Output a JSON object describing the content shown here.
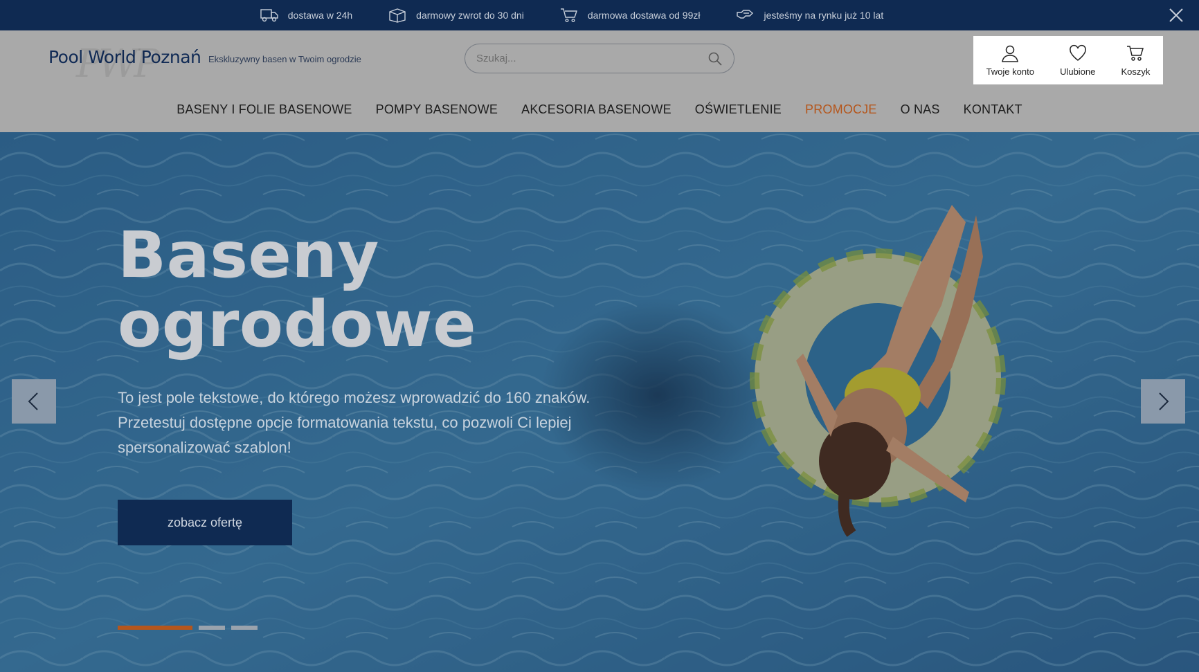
{
  "topbar": {
    "items": [
      {
        "icon": "delivery-truck-icon",
        "label": "dostawa w 24h"
      },
      {
        "icon": "return-box-icon",
        "label": "darmowy zwrot do 30 dni"
      },
      {
        "icon": "cart-icon",
        "label": "darmowa dostawa od 99zł"
      },
      {
        "icon": "handshake-icon",
        "label": "jesteśmy na rynku już 10 lat"
      }
    ],
    "close_icon": "close-icon"
  },
  "header": {
    "logo": "Pool World Poznań",
    "logo_mark": "PWP",
    "tagline": "Ekskluzywny basen w Twoim ogrodzie",
    "search_placeholder": "Szukaj...",
    "account": "Twoje konto",
    "favorites": "Ulubione",
    "cart": "Koszyk"
  },
  "nav": [
    {
      "label": "BASENY I FOLIE BASENOWE"
    },
    {
      "label": "POMPY BASENOWE"
    },
    {
      "label": "AKCESORIA BASENOWE"
    },
    {
      "label": "OŚWIETLENIE"
    },
    {
      "label": "PROMOCJE",
      "highlight": true
    },
    {
      "label": "O NAS"
    },
    {
      "label": "KONTAKT"
    }
  ],
  "hero": {
    "title_line1": "Baseny",
    "title_line2": "ogrodowe",
    "text": "To jest pole tekstowe, do którego możesz wprowadzić do 160 znaków. Przetestuj dostępne opcje formatowania tekstu, co pozwoli Ci lepiej spersonalizować szablon!",
    "button": "zobacz ofertę",
    "slides": 3,
    "active_slide": 1
  },
  "colors": {
    "navy": "#0f2a52",
    "accent": "#b5561c",
    "header_bg": "#a9a9a9"
  }
}
